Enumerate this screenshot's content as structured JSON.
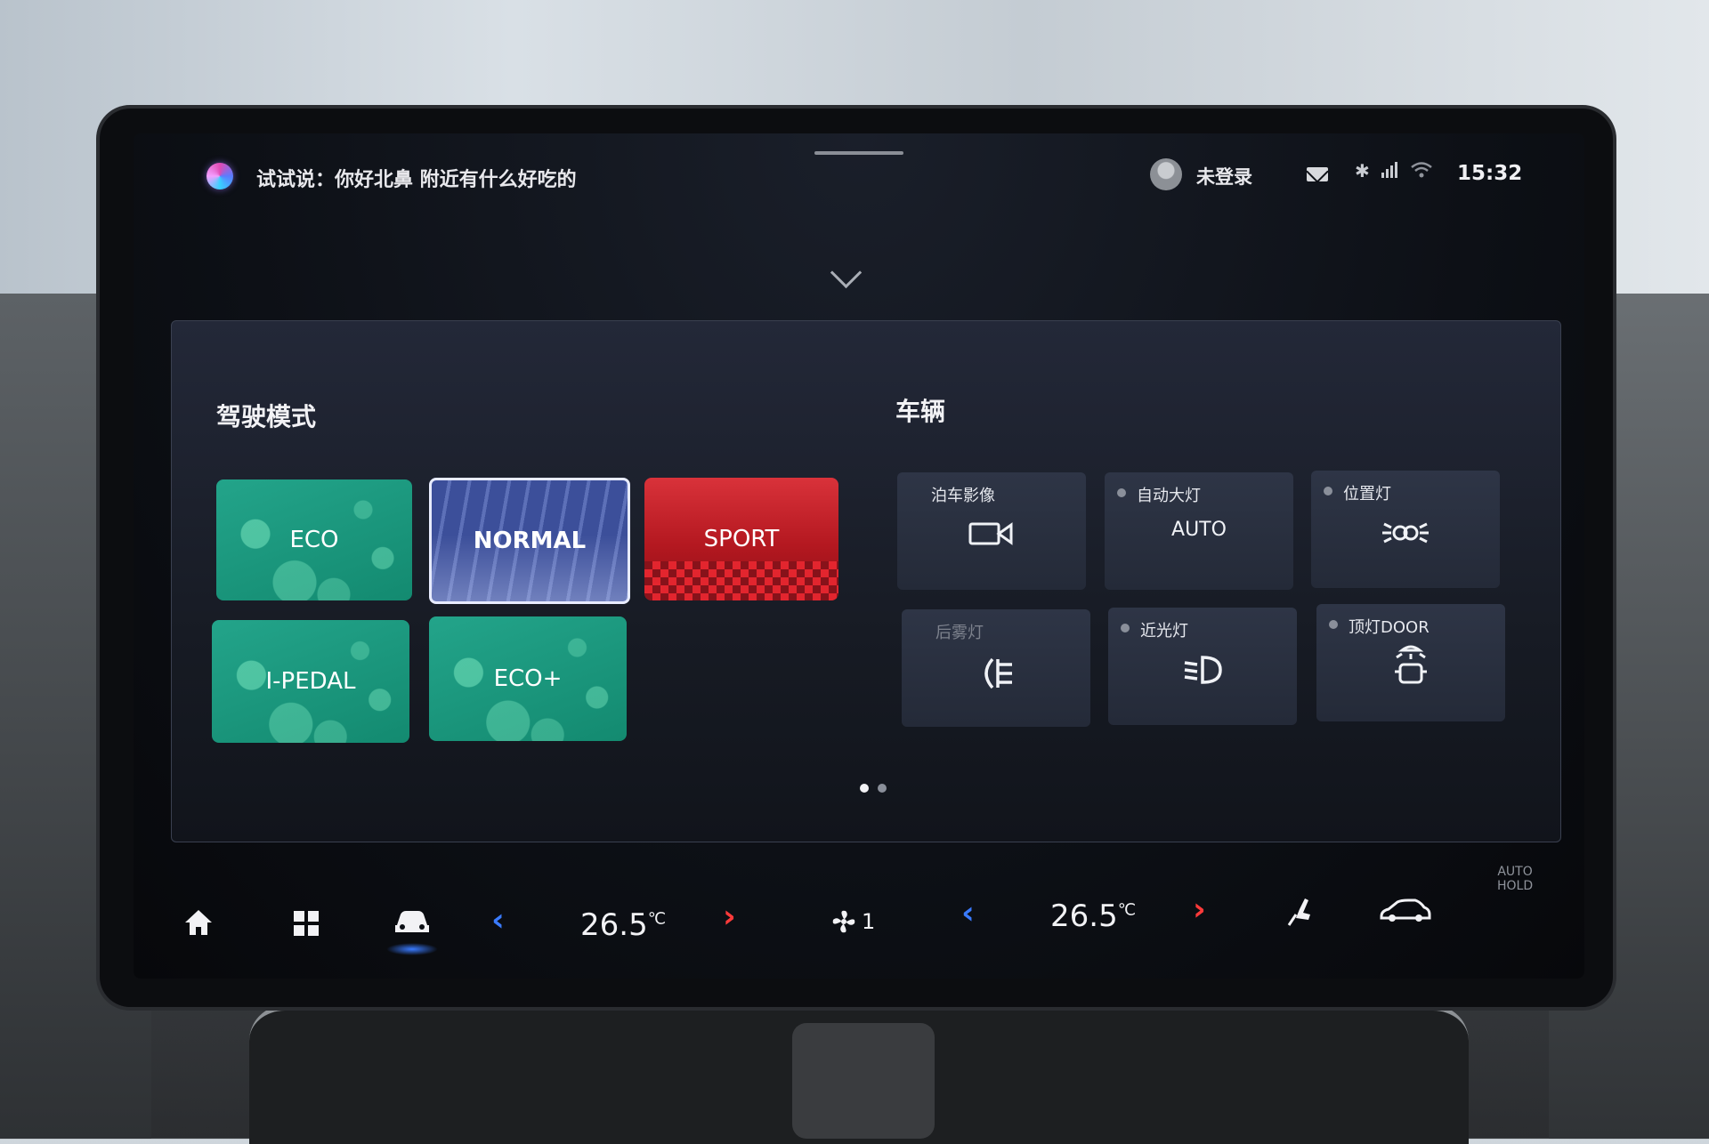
{
  "status_bar": {
    "assistant_hint": "试试说：你好北鼻 附近有什么好吃的",
    "user_label": "未登录",
    "time": "15:32",
    "icons": [
      "assistant-orb-icon",
      "avatar-icon",
      "mail-icon",
      "bluetooth-icon",
      "signal-4g-icon",
      "wifi-icon",
      "chevron-down-icon"
    ]
  },
  "drive_modes": {
    "title": "驾驶模式",
    "modes": [
      {
        "label": "ECO",
        "selected": false,
        "color": "#1f9c84"
      },
      {
        "label": "NORMAL",
        "selected": true,
        "color": "#4a5fae"
      },
      {
        "label": "SPORT",
        "selected": false,
        "color": "#d1262e"
      },
      {
        "label": "I-PEDAL",
        "selected": false,
        "color": "#1f9c84"
      },
      {
        "label": "ECO+",
        "selected": false,
        "color": "#1f9c84"
      }
    ]
  },
  "vehicle": {
    "title": "车辆",
    "tiles": [
      {
        "label": "泊车影像",
        "icon": "camera-icon",
        "has_dot": false
      },
      {
        "label": "自动大灯",
        "value": "AUTO",
        "has_dot": true
      },
      {
        "label": "位置灯",
        "icon": "position-light-icon",
        "has_dot": true
      },
      {
        "label": "后雾灯",
        "icon": "rear-fog-light-icon",
        "has_dot": false,
        "disabled": true
      },
      {
        "label": "近光灯",
        "icon": "low-beam-icon",
        "has_dot": true
      },
      {
        "label": "顶灯DOOR",
        "icon": "dome-light-icon",
        "has_dot": true
      }
    ]
  },
  "pager": {
    "pages": 2,
    "current": 1
  },
  "dock": {
    "left_temp": "26.5",
    "right_temp": "26.5",
    "temp_unit": "℃",
    "fan_level": "1",
    "auto_hold": [
      "AUTO",
      "HOLD"
    ],
    "accent": "#3a7bff",
    "warm": "#ff3a3a"
  }
}
